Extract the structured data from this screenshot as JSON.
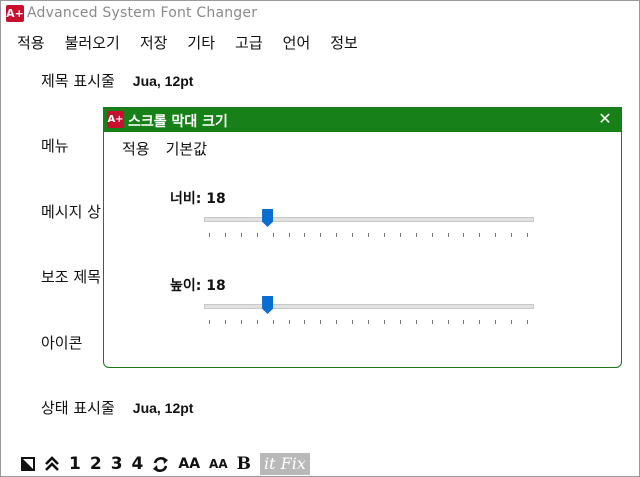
{
  "window": {
    "app_icon_text": "A+",
    "title": "Advanced System Font Changer"
  },
  "menu": [
    "적용",
    "불러오기",
    "저장",
    "기타",
    "고급",
    "언어",
    "정보"
  ],
  "rows": [
    {
      "label": "제목 표시줄",
      "value": "Jua, 12pt"
    },
    {
      "label": "메뉴",
      "value": ""
    },
    {
      "label": "메시지 상",
      "value": ""
    },
    {
      "label": "보조 제목",
      "value": ""
    },
    {
      "label": "아이콘",
      "value": ""
    },
    {
      "label": "상태 표시줄",
      "value": "Jua, 12pt"
    }
  ],
  "toolbar": {
    "items": [
      "1",
      "2",
      "3",
      "4"
    ],
    "aa_large": "AA",
    "aa_small": "AA",
    "bold": "B",
    "fix_label": "it Fix"
  },
  "dialog": {
    "icon_text": "A+",
    "title": "스크롤 막대 크기",
    "close": "✕",
    "menu": [
      "적용",
      "기본값"
    ],
    "width": {
      "label": "너비: 18",
      "value": 18,
      "min": 0,
      "max": 100
    },
    "height": {
      "label": "높이: 18",
      "value": 18,
      "min": 0,
      "max": 100
    },
    "tick_count": 21
  },
  "colors": {
    "dialog_title_bg": "#188018",
    "slider_thumb": "#0a6ed1",
    "app_icon_bg": "#c8102e"
  }
}
